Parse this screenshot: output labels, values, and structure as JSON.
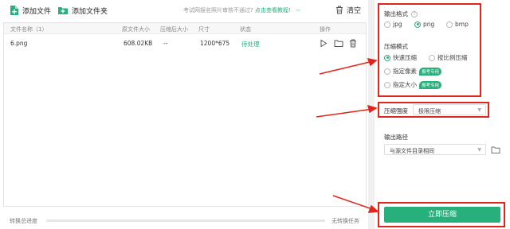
{
  "toolbar": {
    "add_file": "添加文件",
    "add_folder": "添加文件夹",
    "notice": "考试网报名照片审核不通过?",
    "notice_link": "点击查看教程!",
    "notice_chevrons": "›››",
    "clear": "清空"
  },
  "table": {
    "headers": {
      "name": "文件名称（1）",
      "orig_size": "原文件大小",
      "comp_size": "压缩后大小",
      "dims": "尺寸",
      "status": "状态",
      "ops": "操作"
    },
    "rows": [
      {
        "name": "6.png",
        "orig_size": "608.02KB",
        "comp_size": "--",
        "dims": "1200*675",
        "status": "待处理"
      }
    ]
  },
  "footer": {
    "progress_label": "转换总进度",
    "progress": 0,
    "task_status": "无转换任务"
  },
  "panel": {
    "output_format": {
      "title": "输出格式",
      "options": [
        "jpg",
        "png",
        "bmp"
      ],
      "selected": "png"
    },
    "compress_mode": {
      "title": "压缩模式",
      "options": [
        "快速压缩",
        "按比例压缩",
        "指定像素",
        "指定大小"
      ],
      "selected": "快速压缩",
      "badge": "报考专用"
    },
    "strength": {
      "title": "压缩强度",
      "value": "极限压缩"
    },
    "output_path": {
      "title": "输出路径",
      "value": "与源文件目录相同"
    },
    "compress_button": "立即压缩"
  },
  "colors": {
    "accent": "#27b07c",
    "annotation": "#e0261c"
  },
  "icons": [
    "add-file-icon",
    "add-folder-icon",
    "trash-icon",
    "play-icon",
    "folder-icon",
    "help-icon",
    "chevron-down-icon"
  ]
}
